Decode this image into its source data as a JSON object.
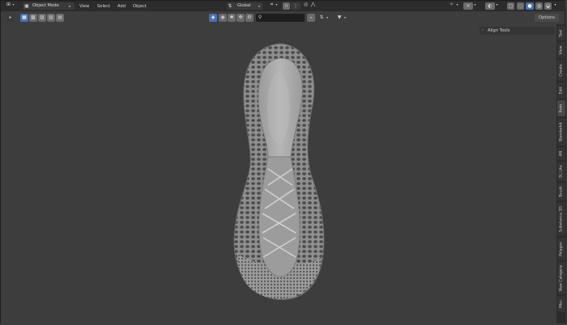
{
  "header": {
    "mode": "Object Mode",
    "menus": [
      "View",
      "Select",
      "Add",
      "Object"
    ],
    "transform_orientation": "Global",
    "options_label": "Options"
  },
  "search": {
    "placeholder": ""
  },
  "npanel": {
    "panel_title": "Align Tools"
  },
  "sidebar": {
    "tabs": [
      "Tool",
      "View",
      "Create",
      "Edit",
      "Item",
      "Blenderkit",
      "AN",
      "SL Lite",
      "Brush",
      "Substance 3D",
      "Polygon",
      "New Category",
      "Misc"
    ]
  },
  "icons": {
    "editor_type": "cube-grid-icon",
    "cursor": "cursor-icon",
    "snap": "magnet-icon",
    "proportional": "circle-dot-icon",
    "filter": "filter-icon",
    "overlays": "overlays-icon",
    "gizmo": "gizmo-icon"
  }
}
